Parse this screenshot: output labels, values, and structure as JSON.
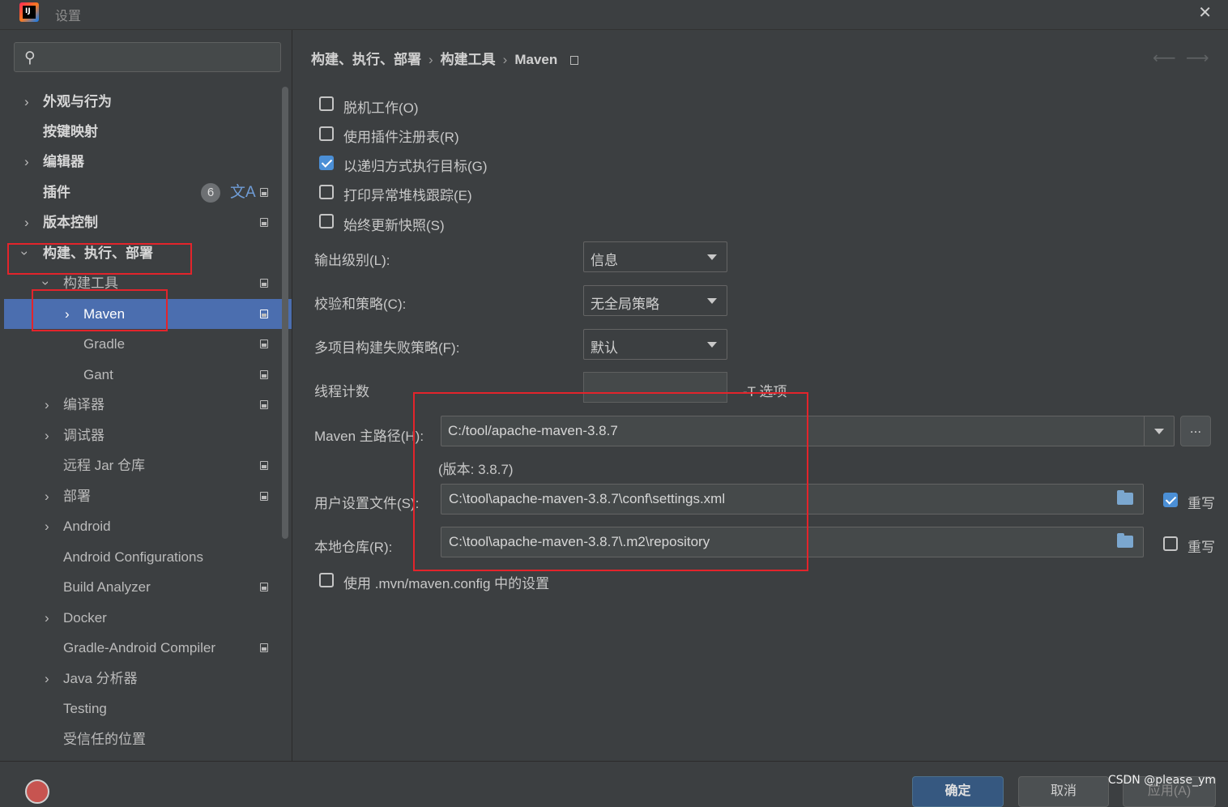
{
  "window": {
    "title": "设置",
    "close_glyph": "✕"
  },
  "search": {
    "placeholder": ""
  },
  "sidebar": {
    "items": [
      {
        "label": "外观与行为",
        "badge": ""
      },
      {
        "label": "按键映射"
      },
      {
        "label": "编辑器"
      },
      {
        "label": "插件",
        "badge": "6"
      },
      {
        "label": "版本控制"
      },
      {
        "label": "构建、执行、部署"
      },
      {
        "label": "构建工具"
      },
      {
        "label": "Maven"
      },
      {
        "label": "Gradle"
      },
      {
        "label": "Gant"
      },
      {
        "label": "编译器"
      },
      {
        "label": "调试器"
      },
      {
        "label": "远程 Jar 仓库"
      },
      {
        "label": "部署"
      },
      {
        "label": "Android"
      },
      {
        "label": "Android Configurations"
      },
      {
        "label": "Build Analyzer"
      },
      {
        "label": "Docker"
      },
      {
        "label": "Gradle-Android Compiler"
      },
      {
        "label": "Java 分析器"
      },
      {
        "label": "Testing"
      },
      {
        "label": "受信任的位置"
      }
    ]
  },
  "breadcrumb": {
    "parts": [
      "构建、执行、部署",
      "构建工具",
      "Maven"
    ],
    "separator": "›",
    "back_glyph": "⟵",
    "forward_glyph": "⟶"
  },
  "options": {
    "checkboxes": [
      {
        "label": "脱机工作(O)",
        "checked": false
      },
      {
        "label": "使用插件注册表(R)",
        "checked": false
      },
      {
        "label": "以递归方式执行目标(G)",
        "checked": true
      },
      {
        "label": "打印异常堆栈跟踪(E)",
        "checked": false
      },
      {
        "label": "始终更新快照(S)",
        "checked": false
      }
    ],
    "output_level": {
      "label": "输出级别(L):",
      "value": "信息"
    },
    "checksum_policy": {
      "label": "校验和策略(C):",
      "value": "无全局策略"
    },
    "multiproject_fail": {
      "label": "多项目构建失败策略(F):",
      "value": "默认"
    },
    "thread_count": {
      "label": "线程计数",
      "value": "",
      "hint": "-T 选项"
    },
    "maven_home": {
      "label": "Maven 主路径(H):",
      "value": "C:/tool/apache-maven-3.8.7",
      "browse": "...",
      "version": "(版本: 3.8.7)"
    },
    "user_settings": {
      "label": "用户设置文件(S):",
      "value": "C:\\tool\\apache-maven-3.8.7\\conf\\settings.xml",
      "override_label": "重写",
      "override": true
    },
    "local_repo": {
      "label": "本地仓库(R):",
      "value": "C:\\tool\\apache-maven-3.8.7\\.m2\\repository",
      "override_label": "重写",
      "override": false
    },
    "use_mvn_config": {
      "label": "使用 .mvn/maven.config 中的设置",
      "checked": false
    }
  },
  "buttons": {
    "ok": "确定",
    "cancel": "取消",
    "apply": "应用(A)"
  },
  "watermark": "CSDN @please_ym",
  "colors": {
    "selection": "#4b6eaf",
    "annotation": "#e3242b",
    "accent": "#4b8fd6"
  }
}
